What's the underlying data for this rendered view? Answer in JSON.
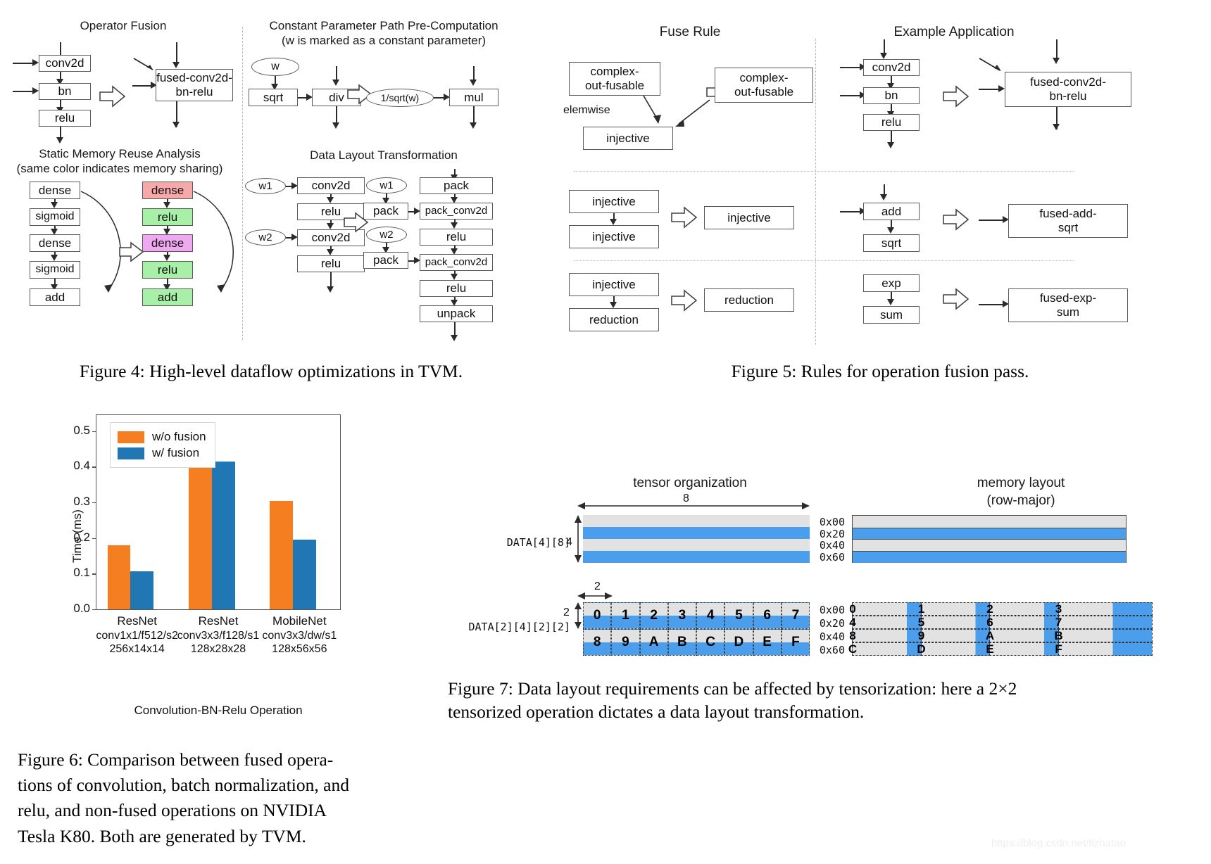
{
  "figure4": {
    "caption": "Figure 4: High-level dataflow optimizations in TVM.",
    "panels": {
      "operator_fusion": {
        "title": "Operator Fusion",
        "left_nodes": [
          "conv2d",
          "bn",
          "relu"
        ],
        "right_node": "fused-conv2d-\nbn-relu"
      },
      "const_path": {
        "title_line1": "Constant Parameter Path Pre-Computation",
        "title_line2": "(w is marked as a constant parameter)",
        "left_oval": "w",
        "left_nodes": [
          "sqrt",
          "div"
        ],
        "right_oval": "1/sqrt(w)",
        "right_node": "mul"
      },
      "memory_reuse": {
        "title_line1": "Static Memory Reuse Analysis",
        "title_line2": "(same color indicates memory sharing)",
        "left_nodes": [
          "dense",
          "sigmoid",
          "dense",
          "sigmoid",
          "add"
        ],
        "right_nodes": [
          {
            "label": "dense",
            "color": "#f7a8a8"
          },
          {
            "label": "relu",
            "color": "#a8f0a8"
          },
          {
            "label": "dense",
            "color": "#f0a8f0"
          },
          {
            "label": "relu",
            "color": "#a8f0a8"
          },
          {
            "label": "add",
            "color": "#a8f0a8"
          }
        ]
      },
      "data_layout": {
        "title": "Data Layout Transformation",
        "left_ovals": [
          "w1",
          "w2"
        ],
        "left_nodes": [
          "conv2d",
          "relu",
          "conv2d",
          "relu"
        ],
        "right_ovals": [
          "w1",
          "w2"
        ],
        "right_pack_nodes": [
          "pack",
          "pack"
        ],
        "right_nodes": [
          "pack",
          "pack_conv2d",
          "relu",
          "pack_conv2d",
          "relu",
          "unpack"
        ]
      }
    }
  },
  "figure5": {
    "caption": "Figure 5: Rules for operation fusion pass.",
    "col_left_title": "Fuse Rule",
    "col_right_title": "Example Application",
    "rows": [
      {
        "rule_src_top": "complex-\nout-fusable",
        "rule_src_bottom": "injective",
        "rule_edge_label": "elemwise",
        "rule_result": "complex-\nout-fusable",
        "example_src": [
          "conv2d",
          "bn",
          "relu"
        ],
        "example_result": "fused-conv2d-\nbn-relu"
      },
      {
        "rule_src_top": "injective",
        "rule_src_bottom": "injective",
        "rule_edge_label": "",
        "rule_result": "injective",
        "example_src": [
          "add",
          "sqrt"
        ],
        "example_result": "fused-add-\nsqrt"
      },
      {
        "rule_src_top": "injective",
        "rule_src_bottom": "reduction",
        "rule_edge_label": "",
        "rule_result": "reduction",
        "example_src": [
          "exp",
          "sum"
        ],
        "example_result": "fused-exp-\nsum"
      }
    ]
  },
  "figure6": {
    "caption": "Figure 6:  Comparison between fused opera-tions of convolution, batch normalization, and relu, and non-fused operations on NVIDIA Tesla K80. Both are generated by TVM.",
    "caption_lines": [
      "Figure 6:  Comparison between fused opera-",
      "tions of convolution, batch normalization, and",
      "relu, and non-fused operations on NVIDIA",
      "Tesla K80. Both are generated by TVM."
    ]
  },
  "chart_data": {
    "type": "bar",
    "title": "",
    "xlabel": "Convolution-BN-Relu Operation",
    "ylabel": "Time (ms)",
    "ylim": [
      0.0,
      0.545
    ],
    "yticks": [
      "0.0",
      "0.1",
      "0.2",
      "0.3",
      "0.4",
      "0.5"
    ],
    "ytickvals": [
      0.0,
      0.1,
      0.2,
      0.3,
      0.4,
      0.5
    ],
    "grid": false,
    "legend_position": "upper left",
    "categories": [
      {
        "line1": "ResNet",
        "line2": "conv1x1/f512/s2",
        "line3": "256x14x14"
      },
      {
        "line1": "ResNet",
        "line2": "conv3x3/f128/s1",
        "line3": "128x28x28"
      },
      {
        "line1": "MobileNet",
        "line2": "conv3x3/dw/s1",
        "line3": "128x56x56"
      }
    ],
    "series": [
      {
        "name": "w/o fusion",
        "color": "#f57f20",
        "values": [
          0.18,
          0.511,
          0.304
        ]
      },
      {
        "name": "w/ fusion",
        "color": "#2077b4",
        "values": [
          0.106,
          0.414,
          0.196
        ]
      }
    ]
  },
  "figure7": {
    "caption_lines": [
      "Figure 7:  Data layout requirements can be affected by tensorization:  here a 2×2",
      "tensorized operation dictates a data layout transformation."
    ],
    "left_title": "tensor organization",
    "right_title_line1": "memory layout",
    "right_title_line2": "(row-major)",
    "top": {
      "data_label": "DATA[4][8]",
      "width_dim": "8",
      "height_dim": "4",
      "row_colors": [
        "#e2e2e2",
        "#4a9eeb",
        "#e2e2e2",
        "#4a9eeb"
      ],
      "addresses": [
        "0x00",
        "0x20",
        "0x40",
        "0x60"
      ]
    },
    "bottom": {
      "data_label": "DATA[2][4][2][2]",
      "width_dim": "2",
      "height_dim": "2",
      "tensor_rows": [
        [
          "0",
          "1",
          "2",
          "3",
          "4",
          "5",
          "6",
          "7"
        ],
        [
          "8",
          "9",
          "A",
          "B",
          "C",
          "D",
          "E",
          "F"
        ]
      ],
      "memory_addresses": [
        "0x00",
        "0x20",
        "0x40",
        "0x60"
      ],
      "memory_rows": [
        [
          "0",
          "1",
          "2",
          "3"
        ],
        [
          "4",
          "5",
          "6",
          "7"
        ],
        [
          "8",
          "9",
          "A",
          "B"
        ],
        [
          "C",
          "D",
          "E",
          "F"
        ]
      ]
    },
    "colors": {
      "gray": "#e2e2e2",
      "blue": "#4a9eeb"
    }
  },
  "watermark": "https://blog.csdn.net/tlzhatao"
}
